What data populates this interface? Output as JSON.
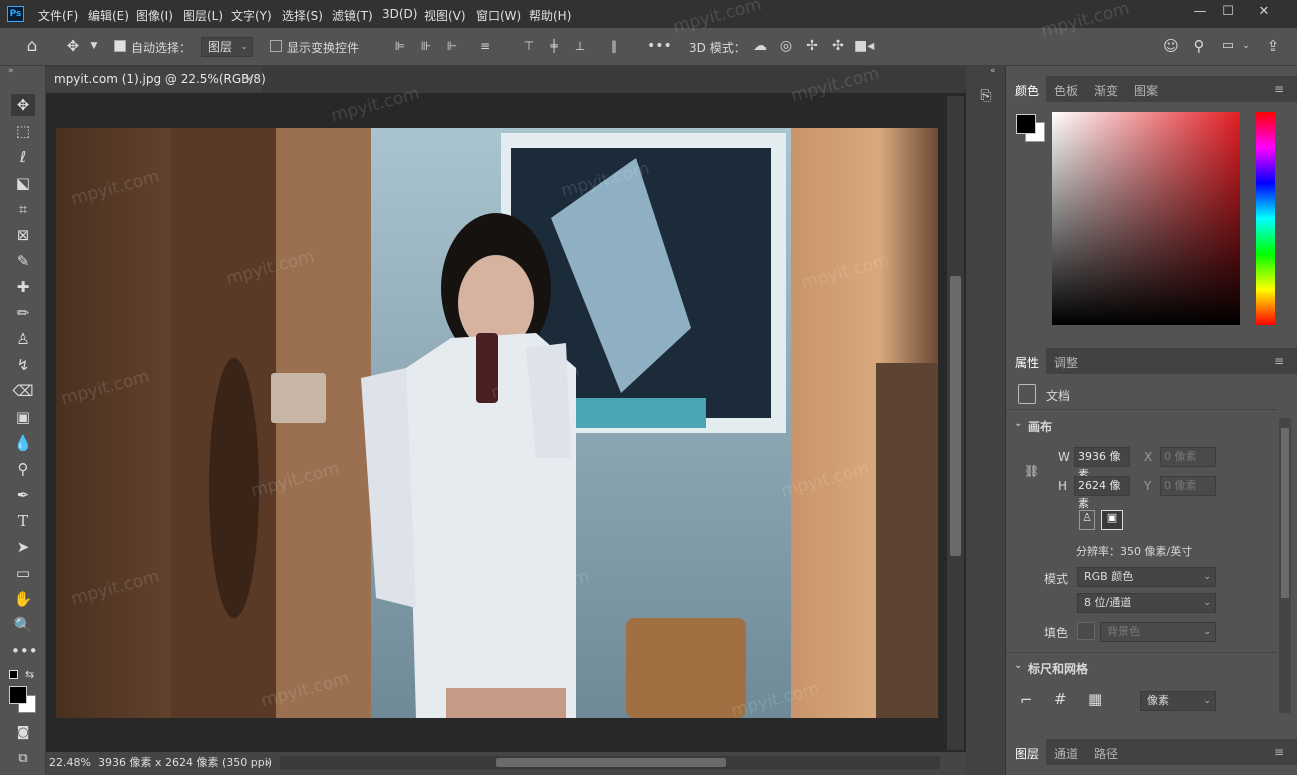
{
  "app": {
    "logo": "Ps",
    "accent": "#31a8ff"
  },
  "menu": [
    "文件(F)",
    "编辑(E)",
    "图像(I)",
    "图层(L)",
    "文字(Y)",
    "选择(S)",
    "滤镜(T)",
    "3D(D)",
    "视图(V)",
    "窗口(W)",
    "帮助(H)"
  ],
  "window_controls": {
    "minimize": "—",
    "maximize": "☐",
    "close": "✕"
  },
  "options": {
    "auto_select_label": "自动选择：",
    "auto_select_checked": true,
    "auto_select_target": "图层",
    "show_transform_label": "显示变换控件",
    "show_transform_checked": false,
    "three_d_mode_label": "3D 模式："
  },
  "document": {
    "tab_title": "mpyit.com (1).jpg @ 22.5%(RGB/8)",
    "tab_close": "×",
    "watermark": "mpyit.com"
  },
  "status": {
    "zoom": "22.48%",
    "dimensions": "3936 像素 x 2624 像素 (350 ppi)",
    "arrow": "›"
  },
  "color_panel": {
    "tabs": [
      "颜色",
      "色板",
      "渐变",
      "图案"
    ],
    "foreground": "#000000",
    "background": "#ffffff",
    "hue_color": "#e31e24"
  },
  "properties_panel": {
    "tabs": [
      "属性",
      "调整"
    ],
    "doc_label": "文档",
    "canvas_section": "画布",
    "w_label": "W",
    "w_value": "3936 像素",
    "h_label": "H",
    "h_value": "2624 像素",
    "x_label": "X",
    "x_value": "0 像素",
    "y_label": "Y",
    "y_value": "0 像素",
    "resolution": "分辨率：350 像素/英寸",
    "mode_label": "模式",
    "mode_value": "RGB 颜色",
    "depth_value": "8 位/通道",
    "fill_label": "填色",
    "fill_value": "背景色",
    "rulers_section": "标尺和网格",
    "units_value": "像素"
  },
  "layers_panel": {
    "tabs": [
      "图层",
      "通道",
      "路径"
    ]
  }
}
